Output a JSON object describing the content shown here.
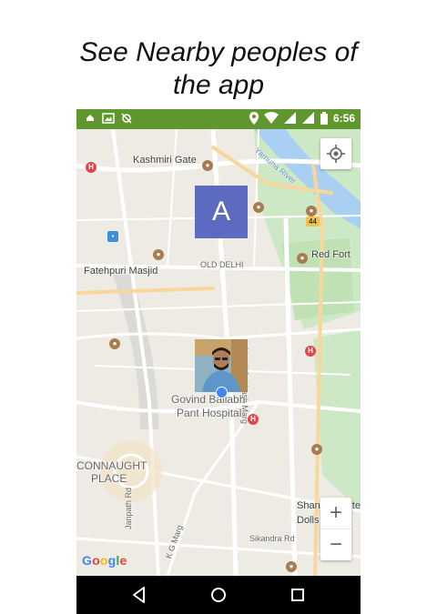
{
  "caption": {
    "line1": "See Nearby peoples of",
    "line2": "the app"
  },
  "status_bar": {
    "time": "6:56",
    "color": "#5f962e",
    "left_icons": [
      "cloud-icon",
      "image-icon",
      "no-gps-icon"
    ],
    "right_icons": [
      "location-icon",
      "wifi-icon",
      "signal-icon",
      "signal-icon",
      "battery-icon"
    ]
  },
  "map": {
    "labels": {
      "kashmiri_gate": "Kashmiri Gate",
      "red_fort": "Red Fort",
      "fatehpuri_masjid": "Fatehpuri Masjid",
      "old_delhi": "OLD DELHI",
      "netaji_subhash_marg": "Netaji Subhash Marg",
      "govind_ballabh": "Govind Ballabh",
      "pant_hospital": "Pant Hospital",
      "connaught": "CONNAUGHT",
      "place": "PLACE",
      "shankars_line1": "Shankar's Inte",
      "shankars_line2": "Dolls Museu",
      "sikandra_rd": "Sikandra Rd",
      "janpath_rd": "Janpath Rd",
      "kg_marg": "K G Marg",
      "yamuna_river": "Yamuna River",
      "highway_44": "44"
    },
    "user_marker_letter": "A",
    "user_marker_color": "#5c6bc0",
    "nearby_user_dot_color": "#4285f4"
  },
  "controls": {
    "zoom_in": "+",
    "zoom_out": "−",
    "my_location_icon": "crosshair-icon"
  },
  "google_logo": [
    "G",
    "o",
    "o",
    "g",
    "l",
    "e"
  ],
  "nav_bar": {
    "back_icon": "back-triangle-icon",
    "home_icon": "home-circle-icon",
    "recents_icon": "recents-square-icon"
  }
}
